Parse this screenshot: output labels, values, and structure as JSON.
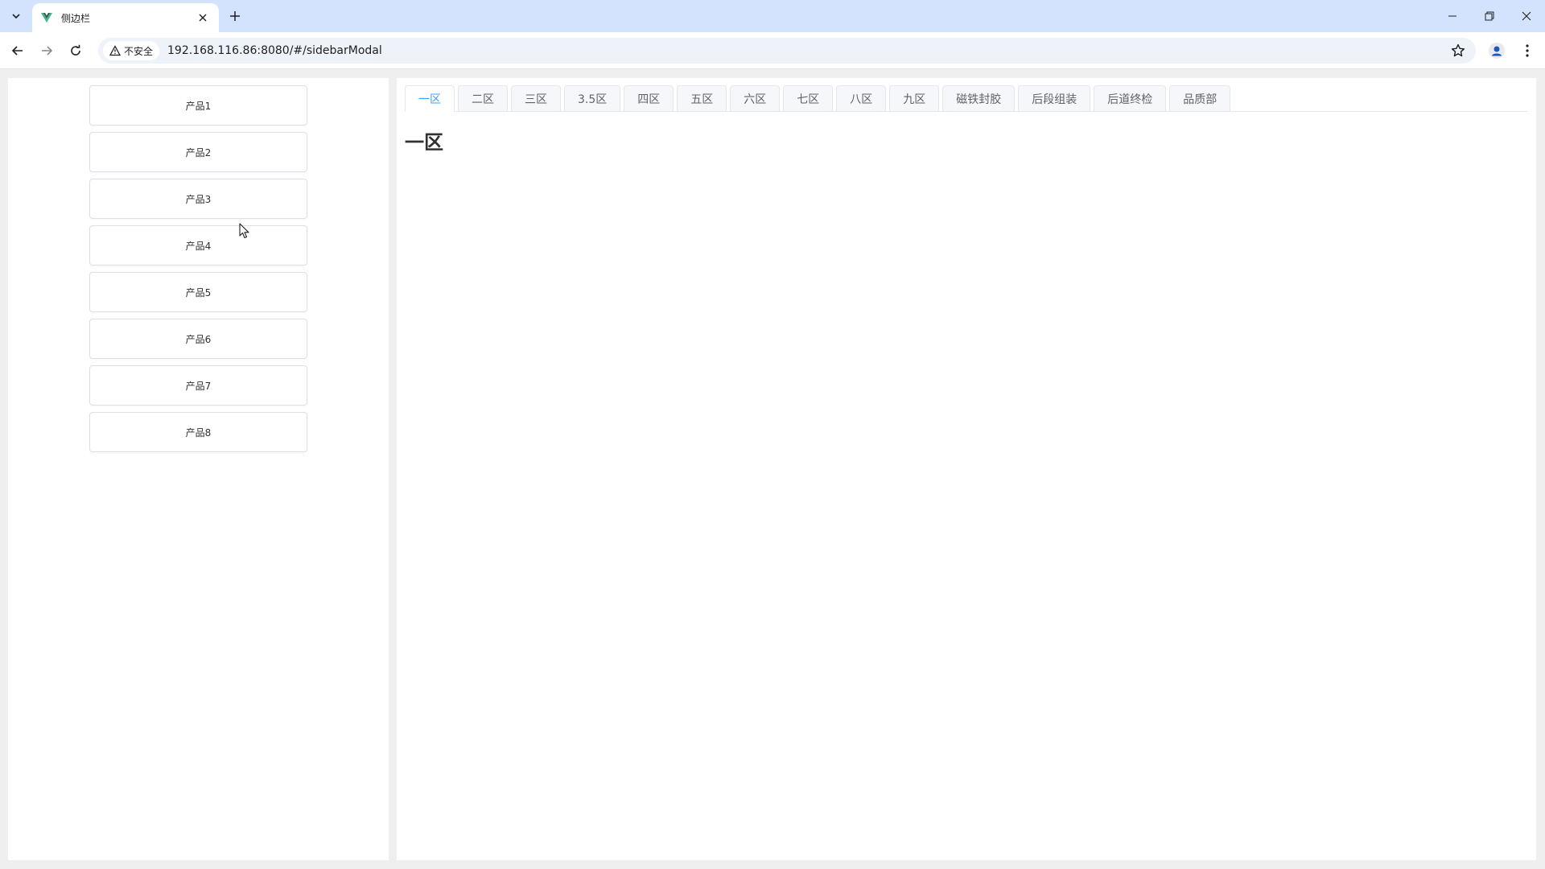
{
  "browser": {
    "tab_title": "侧边栏",
    "url": "192.168.116.86:8080/#/sidebarModal",
    "security_label": "不安全"
  },
  "sidebar": {
    "products": [
      "产品1",
      "产品2",
      "产品3",
      "产品4",
      "产品5",
      "产品6",
      "产品7",
      "产品8"
    ]
  },
  "tabs": {
    "items": [
      "一区",
      "二区",
      "三区",
      "3.5区",
      "四区",
      "五区",
      "六区",
      "七区",
      "八区",
      "九区",
      "磁铁封胶",
      "后段组装",
      "后道终检",
      "品质部"
    ],
    "active_index": 0
  },
  "content": {
    "title": "一区"
  },
  "colors": {
    "accent": "#409eff",
    "tabbar": "#d3e3fd"
  }
}
